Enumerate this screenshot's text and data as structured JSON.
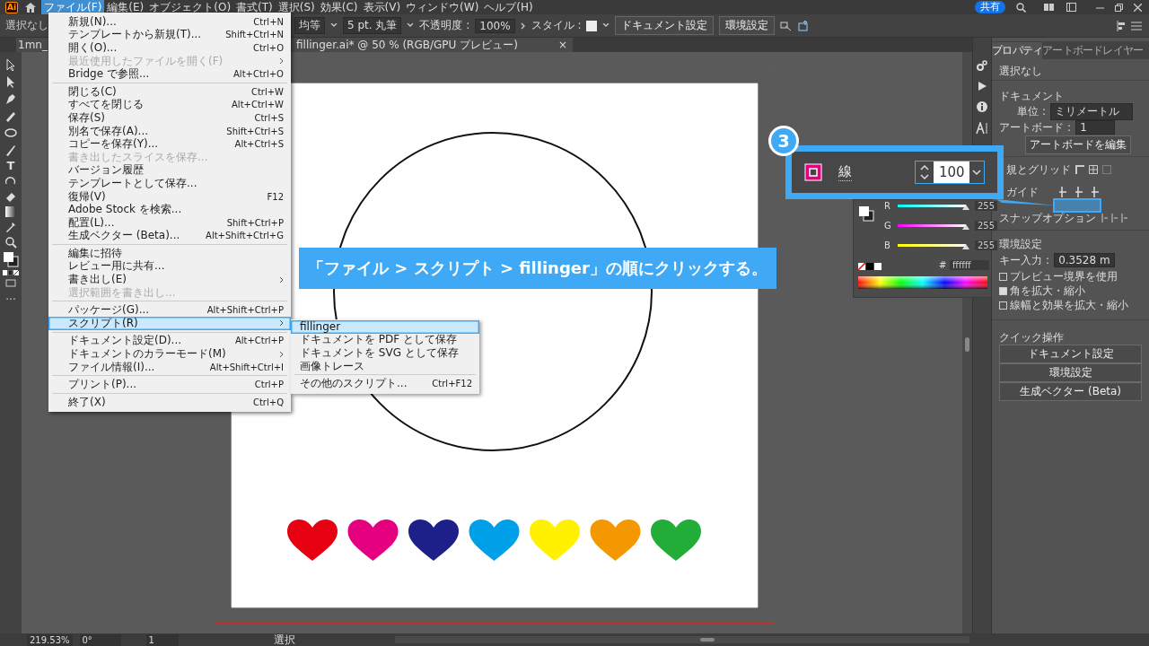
{
  "menubar": {
    "logo": "Ai",
    "menus": [
      {
        "label": "ファイル(F)",
        "selected": true
      },
      {
        "label": "編集(E)",
        "selected": false
      },
      {
        "label": "オブジェクト(O)",
        "selected": false
      },
      {
        "label": "書式(T)",
        "selected": false
      },
      {
        "label": "選択(S)",
        "selected": false
      },
      {
        "label": "効果(C)",
        "selected": false
      },
      {
        "label": "表示(V)",
        "selected": false
      },
      {
        "label": "ウィンドウ(W)",
        "selected": false
      },
      {
        "label": "ヘルプ(H)",
        "selected": false
      }
    ],
    "share": "共有"
  },
  "control_bar": {
    "selection": "選択なし",
    "profile": "均等",
    "brush": "5 pt. 丸筆",
    "opacity_label": "不透明度 :",
    "opacity": "100%",
    "style_label": "スタイル :",
    "buttons": [
      "ドキュメント設定",
      "環境設定"
    ]
  },
  "document_tab": {
    "left_part": "1mn_",
    "right_part": "fillinger.ai* @ 50 % (RGB/GPU プレビュー)",
    "close": "×"
  },
  "toolbar": {
    "type_tool": "T",
    "more": "..."
  },
  "hearts": [
    {
      "color": "#e60012"
    },
    {
      "color": "#e4007f"
    },
    {
      "color": "#1d2088"
    },
    {
      "color": "#00a0e9"
    },
    {
      "color": "#fff100"
    },
    {
      "color": "#f39800"
    },
    {
      "color": "#22ac38"
    }
  ],
  "file_menu": [
    {
      "kind": "item",
      "label": "新規(N)...",
      "shortcut": "Ctrl+N",
      "disabled": false,
      "submenu": false,
      "selected": false
    },
    {
      "kind": "item",
      "label": "テンプレートから新規(T)...",
      "shortcut": "Shift+Ctrl+N",
      "disabled": false,
      "submenu": false,
      "selected": false
    },
    {
      "kind": "item",
      "label": "開く(O)...",
      "shortcut": "Ctrl+O",
      "disabled": false,
      "submenu": false,
      "selected": false
    },
    {
      "kind": "item",
      "label": "最近使用したファイルを開く(F)",
      "disabled": true,
      "submenu": true,
      "selected": false
    },
    {
      "kind": "item",
      "label": "Bridge で参照...",
      "shortcut": "Alt+Ctrl+O",
      "disabled": false,
      "submenu": false,
      "selected": false
    },
    {
      "kind": "separator"
    },
    {
      "kind": "item",
      "label": "閉じる(C)",
      "shortcut": "Ctrl+W",
      "disabled": false,
      "submenu": false,
      "selected": false
    },
    {
      "kind": "item",
      "label": "すべてを閉じる",
      "shortcut": "Alt+Ctrl+W",
      "disabled": false,
      "submenu": false,
      "selected": false
    },
    {
      "kind": "item",
      "label": "保存(S)",
      "shortcut": "Ctrl+S",
      "disabled": false,
      "submenu": false,
      "selected": false
    },
    {
      "kind": "item",
      "label": "別名で保存(A)...",
      "shortcut": "Shift+Ctrl+S",
      "disabled": false,
      "submenu": false,
      "selected": false
    },
    {
      "kind": "item",
      "label": "コピーを保存(Y)...",
      "shortcut": "Alt+Ctrl+S",
      "disabled": false,
      "submenu": false,
      "selected": false
    },
    {
      "kind": "item",
      "label": "書き出したスライスを保存...",
      "disabled": true,
      "submenu": false,
      "selected": false
    },
    {
      "kind": "item",
      "label": "バージョン履歴",
      "disabled": false,
      "submenu": false,
      "selected": false
    },
    {
      "kind": "item",
      "label": "テンプレートとして保存...",
      "disabled": false,
      "submenu": false,
      "selected": false
    },
    {
      "kind": "item",
      "label": "復帰(V)",
      "shortcut": "F12",
      "disabled": false,
      "submenu": false,
      "selected": false
    },
    {
      "kind": "item",
      "label": "Adobe Stock を検索...",
      "disabled": false,
      "submenu": false,
      "selected": false
    },
    {
      "kind": "item",
      "label": "配置(L)...",
      "shortcut": "Shift+Ctrl+P",
      "disabled": false,
      "submenu": false,
      "selected": false
    },
    {
      "kind": "item",
      "label": "生成ベクター (Beta)...",
      "shortcut": "Alt+Shift+Ctrl+G",
      "disabled": false,
      "submenu": false,
      "selected": false
    },
    {
      "kind": "separator"
    },
    {
      "kind": "item",
      "label": "編集に招待",
      "disabled": false,
      "submenu": false,
      "selected": false
    },
    {
      "kind": "item",
      "label": "レビュー用に共有...",
      "disabled": false,
      "submenu": false,
      "selected": false
    },
    {
      "kind": "item",
      "label": "書き出し(E)",
      "disabled": false,
      "submenu": true,
      "selected": false
    },
    {
      "kind": "item",
      "label": "選択範囲を書き出し...",
      "disabled": true,
      "submenu": false,
      "selected": false
    },
    {
      "kind": "separator"
    },
    {
      "kind": "item",
      "label": "パッケージ(G)...",
      "shortcut": "Alt+Shift+Ctrl+P",
      "disabled": false,
      "submenu": false,
      "selected": false
    },
    {
      "kind": "item",
      "label": "スクリプト(R)",
      "disabled": false,
      "submenu": true,
      "selected": true
    },
    {
      "kind": "separator"
    },
    {
      "kind": "item",
      "label": "ドキュメント設定(D)...",
      "shortcut": "Alt+Ctrl+P",
      "disabled": false,
      "submenu": false,
      "selected": false
    },
    {
      "kind": "item",
      "label": "ドキュメントのカラーモード(M)",
      "disabled": false,
      "submenu": true,
      "selected": false
    },
    {
      "kind": "item",
      "label": "ファイル情報(I)...",
      "shortcut": "Alt+Shift+Ctrl+I",
      "disabled": false,
      "submenu": false,
      "selected": false
    },
    {
      "kind": "separator"
    },
    {
      "kind": "item",
      "label": "プリント(P)...",
      "shortcut": "Ctrl+P",
      "disabled": false,
      "submenu": false,
      "selected": false
    },
    {
      "kind": "separator"
    },
    {
      "kind": "item",
      "label": "終了(X)",
      "shortcut": "Ctrl+Q",
      "disabled": false,
      "submenu": false,
      "selected": false
    }
  ],
  "script_submenu": [
    {
      "kind": "item",
      "label": "fillinger",
      "selected": true
    },
    {
      "kind": "item",
      "label": "ドキュメントを PDF として保存",
      "selected": false
    },
    {
      "kind": "item",
      "label": "ドキュメントを SVG として保存",
      "selected": false
    },
    {
      "kind": "item",
      "label": "画像トレース",
      "selected": false
    },
    {
      "kind": "separator"
    },
    {
      "kind": "item",
      "label": "その他のスクリプト...",
      "shortcut": "Ctrl+F12",
      "selected": false
    }
  ],
  "banner": "「ファイル > スクリプト > fillinger」の順にクリックする。",
  "callout": {
    "step": "3",
    "label": "線",
    "value": "100"
  },
  "color_panel": {
    "channels": [
      {
        "name": "R",
        "value": "255",
        "level": 1
      },
      {
        "name": "G",
        "value": "255",
        "level": 1
      },
      {
        "name": "B",
        "value": "255",
        "level": 1
      }
    ],
    "hash": "#",
    "hex": "ffffff"
  },
  "properties": {
    "tabs": [
      {
        "label": "プロパティ",
        "selected": true
      },
      {
        "label": "アートボード",
        "selected": false
      },
      {
        "label": "レイヤー",
        "selected": false
      }
    ],
    "selection": "選択なし",
    "document_heading": "ドキュメント",
    "unit_label": "単位 :",
    "unit": "ミリメートル",
    "artboard_label": "アートボード :",
    "artboard": "1",
    "edit_artboard": "アートボードを編集",
    "rulers": "規とグリッド",
    "guides": "ガイド",
    "snap": "スナップオプション",
    "prefs_heading": "環境設定",
    "key_label": "キー入力 :",
    "key_value": "0.3528 m",
    "checkboxes": [
      {
        "label": "プレビュー境界を使用",
        "checked": false
      },
      {
        "label": "角を拡大・縮小",
        "checked": true
      },
      {
        "label": "線幅と効果を拡大・縮小",
        "checked": false
      }
    ],
    "quick_heading": "クイック操作",
    "quick_buttons": [
      "ドキュメント設定",
      "環境設定",
      "生成ベクター (Beta)"
    ]
  },
  "status_bar": {
    "zoom": "219.53%",
    "rotation": "0°",
    "artboard": "1",
    "tool": "選択"
  }
}
